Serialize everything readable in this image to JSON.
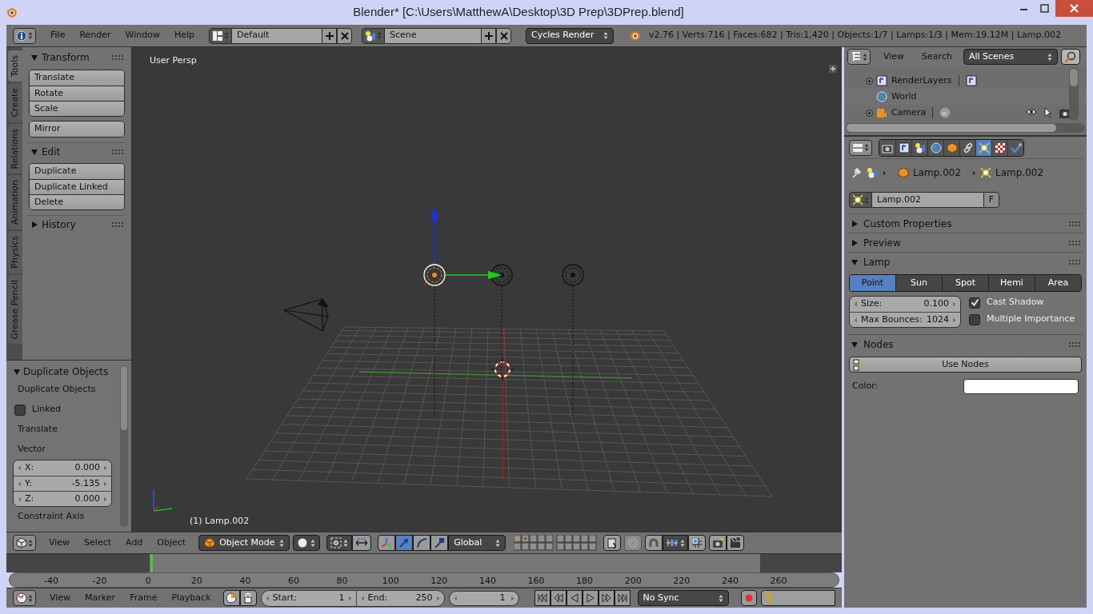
{
  "window": {
    "title": "Blender* [C:\\Users\\MatthewA\\Desktop\\3D Prep\\3DPrep.blend]"
  },
  "info_header": {
    "menus": [
      "File",
      "Render",
      "Window",
      "Help"
    ],
    "screen_layout": "Default",
    "scene": "Scene",
    "render_engine": "Cycles Render",
    "stats": "v2.76 | Verts:716 | Faces:682 | Tris:1,420 | Objects:1/7 | Lamps:1/3 | Mem:19.12M | Lamp.002"
  },
  "tool_shelf": {
    "tabs": [
      {
        "label": "Tools",
        "selected": true
      },
      {
        "label": "Create",
        "selected": false
      },
      {
        "label": "Relations",
        "selected": false
      },
      {
        "label": "Animation",
        "selected": false
      },
      {
        "label": "Physics",
        "selected": false
      },
      {
        "label": "Grease Pencil",
        "selected": false
      }
    ],
    "panels": [
      {
        "title": "Transform",
        "expanded": true,
        "button_groups": [
          [
            "Translate",
            "Rotate",
            "Scale"
          ],
          [
            "Mirror"
          ]
        ]
      },
      {
        "title": "Edit",
        "expanded": true,
        "button_groups": [
          [
            "Duplicate",
            "Duplicate Linked",
            "Delete"
          ]
        ]
      },
      {
        "title": "History",
        "expanded": false
      }
    ]
  },
  "operator_panel": {
    "title": "Duplicate Objects",
    "expanded": true,
    "items": [
      {
        "kind": "label",
        "text": "Duplicate Objects"
      },
      {
        "kind": "checkbox",
        "text": "Linked",
        "checked": false
      },
      {
        "kind": "label",
        "text": "Translate"
      },
      {
        "kind": "label",
        "text": "Vector"
      },
      {
        "kind": "vector",
        "fields": [
          {
            "label": "X:",
            "value": "0.000"
          },
          {
            "label": "Y:",
            "value": "-5.135"
          },
          {
            "label": "Z:",
            "value": "0.000"
          }
        ]
      },
      {
        "kind": "label",
        "text": "Constraint Axis"
      }
    ]
  },
  "viewport": {
    "view_name": "User Persp",
    "active_object": "(1) Lamp.002"
  },
  "view3d_header": {
    "menus": [
      "View",
      "Select",
      "Add",
      "Object"
    ],
    "mode": "Object Mode",
    "manipulators": [
      {
        "kind": "axes",
        "selected": false
      },
      {
        "kind": "translate",
        "selected": true
      },
      {
        "kind": "rotate",
        "selected": false
      },
      {
        "kind": "scale",
        "selected": false
      }
    ],
    "transform_orientation": "Global"
  },
  "timeline": {
    "ticks": [
      "-40",
      "-20",
      "0",
      "20",
      "40",
      "60",
      "80",
      "100",
      "120",
      "140",
      "160",
      "180",
      "200",
      "220",
      "240",
      "260"
    ]
  },
  "timeline_header": {
    "menus": [
      "View",
      "Marker",
      "Frame",
      "Playback"
    ],
    "start": {
      "label": "Start:",
      "value": "1"
    },
    "end": {
      "label": "End:",
      "value": "250"
    },
    "current_frame": "1",
    "sync": "No Sync"
  },
  "outliner": {
    "menus": [
      "View",
      "Search"
    ],
    "display_mode": "All Scenes",
    "items": [
      {
        "kind": "renderlayers",
        "label": "RenderLayers"
      },
      {
        "kind": "world",
        "label": "World"
      },
      {
        "kind": "camera",
        "label": "Camera"
      }
    ]
  },
  "properties": {
    "context_tabs": [
      {
        "kind": "render",
        "selected": false
      },
      {
        "kind": "render_layers",
        "selected": false
      },
      {
        "kind": "scene",
        "selected": false
      },
      {
        "kind": "world",
        "selected": false
      },
      {
        "kind": "object",
        "selected": false
      },
      {
        "kind": "constraints",
        "selected": false
      },
      {
        "kind": "data",
        "selected": true
      },
      {
        "kind": "texture",
        "selected": false
      },
      {
        "kind": "check",
        "selected": false
      }
    ],
    "breadcrumb": [
      "Lamp.002",
      "Lamp.002"
    ],
    "datablock": {
      "name": "Lamp.002",
      "fake_user": "F"
    },
    "panels": [
      {
        "title": "Custom Properties",
        "expanded": false
      },
      {
        "title": "Preview",
        "expanded": false
      }
    ],
    "lamp": {
      "title": "Lamp",
      "expanded": true,
      "types": [
        {
          "label": "Point",
          "selected": true
        },
        {
          "label": "Sun",
          "selected": false
        },
        {
          "label": "Spot",
          "selected": false
        },
        {
          "label": "Hemi",
          "selected": false
        },
        {
          "label": "Area",
          "selected": false
        }
      ],
      "fields": [
        {
          "label": "Size:",
          "value": "0.100"
        },
        {
          "label": "Max Bounces:",
          "value": "1024"
        }
      ],
      "options": [
        {
          "label": "Cast Shadow",
          "checked": true
        },
        {
          "label": "Multiple Importance",
          "checked": false
        }
      ]
    },
    "nodes": {
      "title": "Nodes",
      "expanded": true,
      "button": "Use Nodes",
      "color": {
        "label": "Color:",
        "color": "#ffffff"
      }
    }
  }
}
